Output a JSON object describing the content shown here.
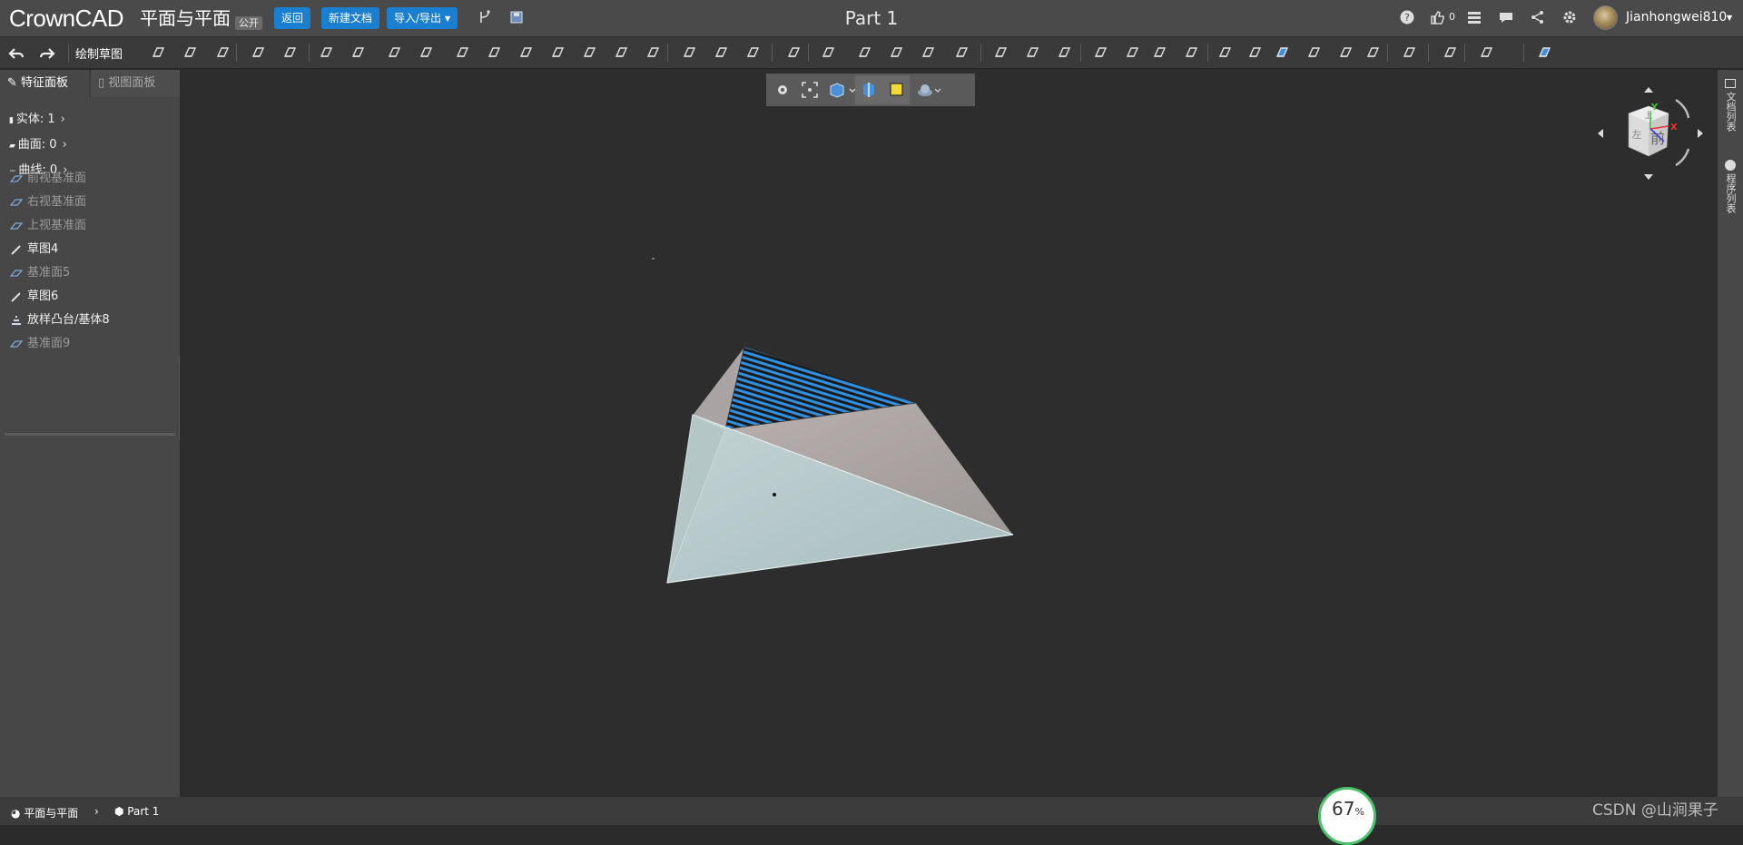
{
  "app": {
    "logo": "CrownCAD",
    "document_title": "平面与平面",
    "document_badge": "公开",
    "part_title": "Part 1"
  },
  "topbar": {
    "back_label": "返回",
    "new_doc_label": "新建文档",
    "import_export_label": "导入/导出",
    "like_count": "0",
    "username": "Jianhongwei810"
  },
  "toolbar": {
    "sketch_label": "绘制草图"
  },
  "left_panel": {
    "tabs": {
      "feature": "特征面板",
      "view": "视图面板"
    },
    "summary": {
      "solids": "实体: 1",
      "surfaces": "曲面: 0",
      "curves": "曲线: 0"
    },
    "tree": [
      {
        "label": "前视基准面",
        "kind": "plane",
        "dim": true
      },
      {
        "label": "右视基准面",
        "kind": "plane",
        "dim": true
      },
      {
        "label": "上视基准面",
        "kind": "plane",
        "dim": true
      },
      {
        "label": "草图4",
        "kind": "sketch",
        "dim": false
      },
      {
        "label": "基准面5",
        "kind": "plane",
        "dim": true
      },
      {
        "label": "草图6",
        "kind": "sketch",
        "dim": false
      },
      {
        "label": "放样凸台/基体8",
        "kind": "loft",
        "dim": false
      },
      {
        "label": "基准面9",
        "kind": "plane",
        "dim": true
      }
    ]
  },
  "right_strip": {
    "doc_list": "文档列表",
    "program_list": "程序列表"
  },
  "view_cube": {
    "front": "前",
    "left": "左",
    "top": "上",
    "axis_x": "X",
    "axis_y": "Y"
  },
  "breadcrumb": {
    "root": "平面与平面",
    "current": "Part 1"
  },
  "status": {
    "zoom_value": "67",
    "zoom_unit": "%"
  },
  "watermark": "CSDN @山涧果子",
  "colors": {
    "accent_blue": "#1a7fd0",
    "face_highlight": "#2f8fe0",
    "zoom_ring": "#4ac26b"
  }
}
